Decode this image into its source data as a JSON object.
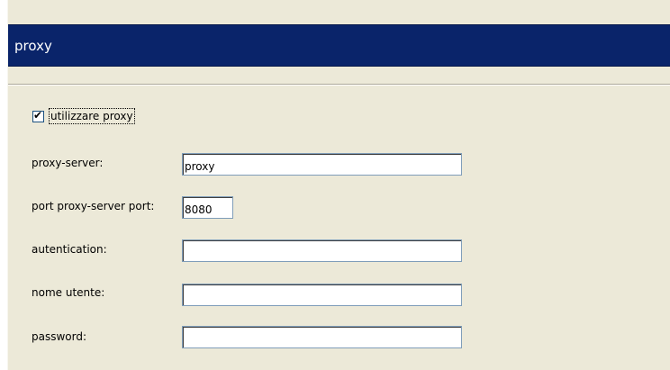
{
  "dialog": {
    "title": "proxy"
  },
  "use_proxy": {
    "label": "utilizzare proxy",
    "checked": true,
    "check_glyph": "✔"
  },
  "fields": {
    "proxy_server": {
      "label": "proxy-server:",
      "value": "proxy"
    },
    "port": {
      "label": "port proxy-server port:",
      "value": "8080"
    },
    "authentication": {
      "label": "autentication:",
      "value": ""
    },
    "username": {
      "label": "nome utente:",
      "value": ""
    },
    "password": {
      "label": "password:",
      "value": ""
    }
  },
  "colors": {
    "title_bar": "#0a246a",
    "window_bg": "#ece9d8",
    "input_border": "#7f9db9"
  }
}
